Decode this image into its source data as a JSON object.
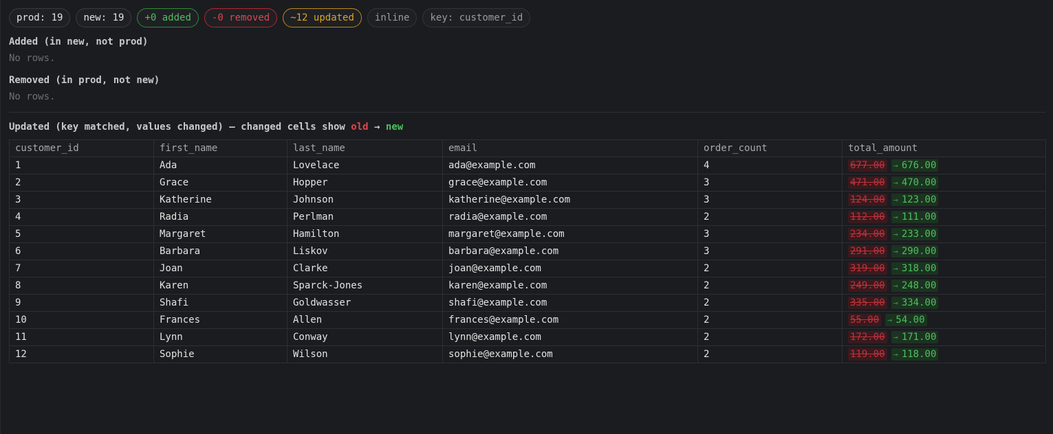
{
  "summary": {
    "prod": "prod: 19",
    "new": "new: 19",
    "added": "+0 added",
    "removed": "-0 removed",
    "updated": "~12 updated",
    "mode": "inline",
    "key": "key: customer_id"
  },
  "added_section": {
    "title": "Added (in new, not prod)",
    "empty": "No rows."
  },
  "removed_section": {
    "title": "Removed (in prod, not new)",
    "empty": "No rows."
  },
  "updated_section": {
    "title_prefix": "Updated (key matched, values changed) — changed cells show ",
    "old_label": "old",
    "arrow": "→",
    "new_label": "new"
  },
  "colors": {
    "added": "#4fbf5e",
    "removed": "#e0454d",
    "updated": "#d9a529",
    "background": "#1b1c20"
  },
  "table": {
    "columns": [
      "customer_id",
      "first_name",
      "last_name",
      "email",
      "order_count",
      "total_amount"
    ],
    "arrow_glyph": "→",
    "rows": [
      {
        "customer_id": "1",
        "first_name": "Ada",
        "last_name": "Lovelace",
        "email": "ada@example.com",
        "order_count": "4",
        "old_total": "677.00",
        "new_total": "676.00"
      },
      {
        "customer_id": "2",
        "first_name": "Grace",
        "last_name": "Hopper",
        "email": "grace@example.com",
        "order_count": "3",
        "old_total": "471.00",
        "new_total": "470.00"
      },
      {
        "customer_id": "3",
        "first_name": "Katherine",
        "last_name": "Johnson",
        "email": "katherine@example.com",
        "order_count": "3",
        "old_total": "124.00",
        "new_total": "123.00"
      },
      {
        "customer_id": "4",
        "first_name": "Radia",
        "last_name": "Perlman",
        "email": "radia@example.com",
        "order_count": "2",
        "old_total": "112.00",
        "new_total": "111.00"
      },
      {
        "customer_id": "5",
        "first_name": "Margaret",
        "last_name": "Hamilton",
        "email": "margaret@example.com",
        "order_count": "3",
        "old_total": "234.00",
        "new_total": "233.00"
      },
      {
        "customer_id": "6",
        "first_name": "Barbara",
        "last_name": "Liskov",
        "email": "barbara@example.com",
        "order_count": "3",
        "old_total": "291.00",
        "new_total": "290.00"
      },
      {
        "customer_id": "7",
        "first_name": "Joan",
        "last_name": "Clarke",
        "email": "joan@example.com",
        "order_count": "2",
        "old_total": "319.00",
        "new_total": "318.00"
      },
      {
        "customer_id": "8",
        "first_name": "Karen",
        "last_name": "Sparck-Jones",
        "email": "karen@example.com",
        "order_count": "2",
        "old_total": "249.00",
        "new_total": "248.00"
      },
      {
        "customer_id": "9",
        "first_name": "Shafi",
        "last_name": "Goldwasser",
        "email": "shafi@example.com",
        "order_count": "2",
        "old_total": "335.00",
        "new_total": "334.00"
      },
      {
        "customer_id": "10",
        "first_name": "Frances",
        "last_name": "Allen",
        "email": "frances@example.com",
        "order_count": "2",
        "old_total": "55.00",
        "new_total": "54.00"
      },
      {
        "customer_id": "11",
        "first_name": "Lynn",
        "last_name": "Conway",
        "email": "lynn@example.com",
        "order_count": "2",
        "old_total": "172.00",
        "new_total": "171.00"
      },
      {
        "customer_id": "12",
        "first_name": "Sophie",
        "last_name": "Wilson",
        "email": "sophie@example.com",
        "order_count": "2",
        "old_total": "119.00",
        "new_total": "118.00"
      }
    ]
  }
}
